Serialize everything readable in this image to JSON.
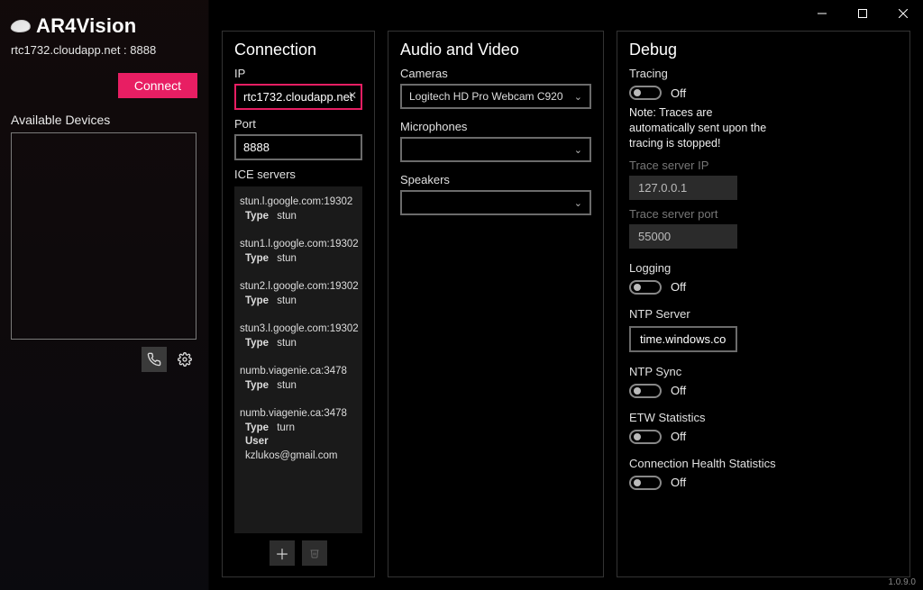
{
  "app": {
    "title": "AR4Vision",
    "subline": "rtc1732.cloudapp.net : 8888",
    "version": "1.0.9.0"
  },
  "sidebar": {
    "connect_label": "Connect",
    "available_label": "Available Devices"
  },
  "connection": {
    "title": "Connection",
    "ip_label": "IP",
    "ip_value": "rtc1732.cloudapp.net",
    "port_label": "Port",
    "port_value": "8888",
    "ice_label": "ICE servers",
    "ice": [
      {
        "url": "stun.l.google.com:19302",
        "rows": [
          [
            "Type",
            "stun"
          ]
        ]
      },
      {
        "url": "stun1.l.google.com:19302",
        "rows": [
          [
            "Type",
            "stun"
          ]
        ]
      },
      {
        "url": "stun2.l.google.com:19302",
        "rows": [
          [
            "Type",
            "stun"
          ]
        ]
      },
      {
        "url": "stun3.l.google.com:19302",
        "rows": [
          [
            "Type",
            "stun"
          ]
        ]
      },
      {
        "url": "numb.viagenie.ca:3478",
        "rows": [
          [
            "Type",
            "stun"
          ]
        ]
      },
      {
        "url": "numb.viagenie.ca:3478",
        "rows": [
          [
            "Type",
            "turn"
          ],
          [
            "User",
            "kzlukos@gmail.com"
          ]
        ]
      }
    ]
  },
  "av": {
    "title": "Audio and Video",
    "cameras_label": "Cameras",
    "camera_selected": "Logitech HD Pro Webcam C920",
    "microphones_label": "Microphones",
    "microphone_selected": "",
    "speakers_label": "Speakers",
    "speaker_selected": ""
  },
  "debug": {
    "title": "Debug",
    "tracing_label": "Tracing",
    "off": "Off",
    "note": "Note: Traces are automatically sent upon the tracing is stopped!",
    "trace_ip_label": "Trace server IP",
    "trace_ip_value": "127.0.0.1",
    "trace_port_label": "Trace server port",
    "trace_port_value": "55000",
    "logging_label": "Logging",
    "ntp_server_label": "NTP Server",
    "ntp_server_value": "time.windows.com",
    "ntp_sync_label": "NTP Sync",
    "etw_label": "ETW Statistics",
    "chs_label": "Connection Health Statistics"
  }
}
